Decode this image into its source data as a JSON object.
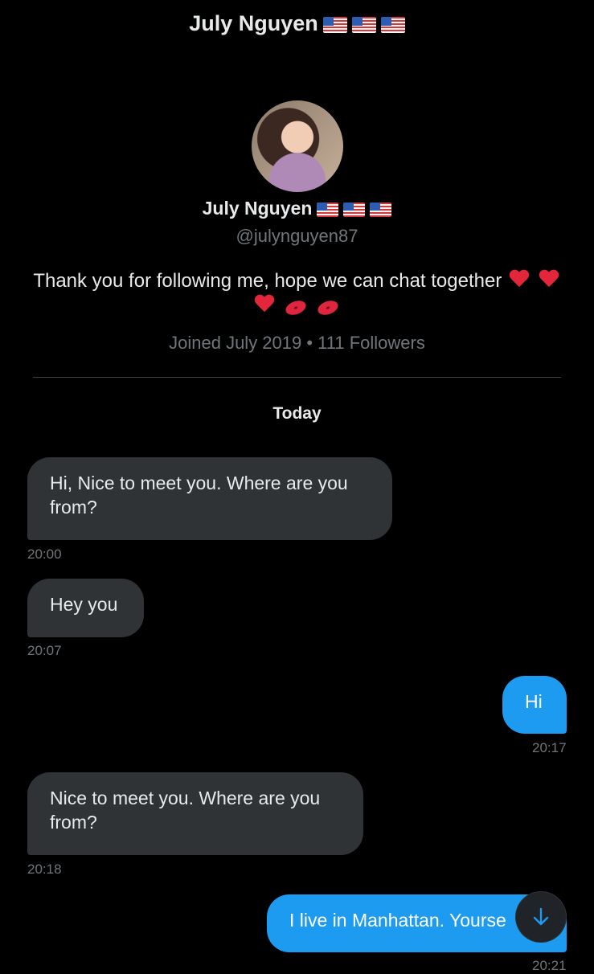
{
  "header": {
    "title": "July Nguyen"
  },
  "profile": {
    "name": "July Nguyen",
    "handle": "@julynguyen87",
    "bio_text": "Thank you for following me, hope we can chat together",
    "meta": "Joined July 2019 • 111 Followers",
    "flag_icon": "us-flag-icon",
    "avatar_icon": "profile-avatar"
  },
  "conversation": {
    "day_label": "Today",
    "messages": [
      {
        "direction": "incoming",
        "text": "Hi, Nice to meet you. Where are you from?",
        "time": "20:00"
      },
      {
        "direction": "incoming",
        "text": "Hey you",
        "time": "20:07"
      },
      {
        "direction": "outgoing",
        "text": "Hi",
        "time": "20:17"
      },
      {
        "direction": "incoming",
        "text": "Nice to meet you. Where are you from?",
        "time": "20:18"
      },
      {
        "direction": "outgoing",
        "text": "I live in Manhattan. Yourse",
        "time": "20:21"
      }
    ]
  },
  "scroll_button": {
    "icon": "arrow-down-icon"
  },
  "colors": {
    "background": "#000000",
    "incoming_bubble": "#2f3336",
    "outgoing_bubble": "#1d9bf0",
    "muted_text": "#71767b"
  }
}
